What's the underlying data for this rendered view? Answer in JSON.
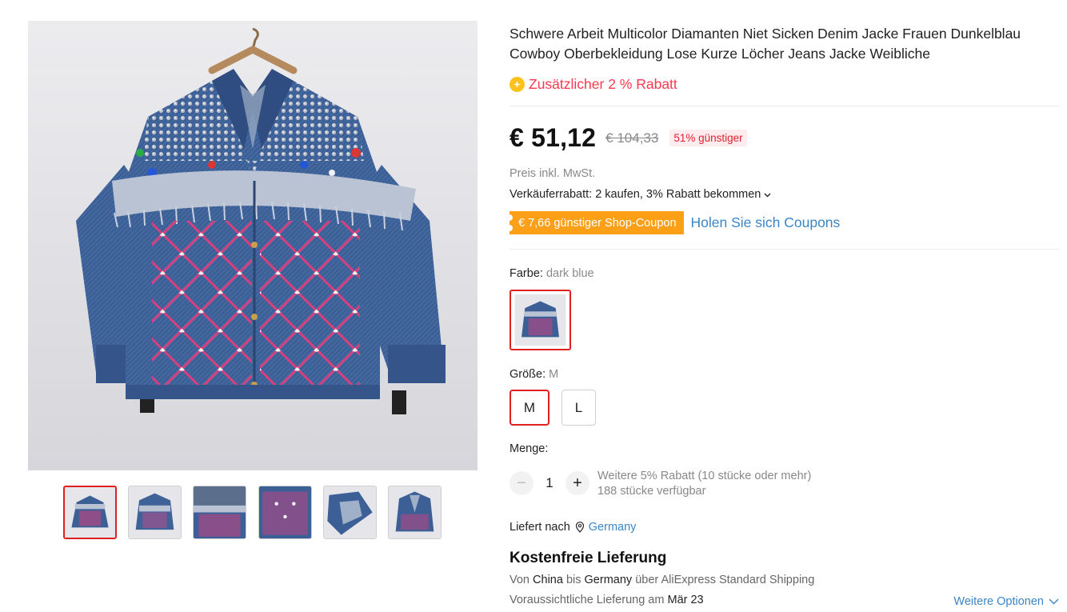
{
  "product": {
    "title": "Schwere Arbeit Multicolor Diamanten Niet Sicken Denim Jacke Frauen Dunkelblau Cowboy Oberbekleidung Lose Kurze Löcher Jeans Jacke Weibliche",
    "extra_discount": "Zusätzlicher 2 % Rabatt"
  },
  "price": {
    "current": "€ 51,12",
    "original": "€ 104,33",
    "discount_badge": "51% günstiger",
    "tax_note": "Preis inkl. MwSt.",
    "seller_discount": "Verkäuferrabatt: 2 kaufen, 3% Rabatt bekommen",
    "coupon_tag": "€ 7,66 günstiger Shop-Coupon",
    "coupon_link": "Holen Sie sich Coupons"
  },
  "color": {
    "label": "Farbe:",
    "value": "dark blue"
  },
  "size": {
    "label": "Größe:",
    "value": "M",
    "options": [
      "M",
      "L"
    ]
  },
  "quantity": {
    "label": "Menge:",
    "value": "1",
    "minus": "−",
    "plus": "+",
    "bulk_note": "Weitere 5% Rabatt (10 stücke oder mehr)",
    "stock_note": "188 stücke verfügbar"
  },
  "shipping": {
    "ship_to_label": "Liefert nach",
    "ship_to_country": "Germany",
    "title": "Kostenfreie Lieferung",
    "route_from": "Von",
    "route_origin": "China",
    "route_to": "bis",
    "route_destination": "Germany",
    "route_method": "über AliExpress Standard Shipping",
    "eta_label": "Voraussichtliche Lieferung am",
    "eta_date": "Mär 23",
    "more_options": "Weitere Optionen"
  },
  "colors": {
    "accent_red": "#e02020",
    "price_red": "#fd384f",
    "coupon_orange": "#fd9f17",
    "link_blue": "#3a86c7",
    "denim_blue": "#3c5f96",
    "bead_pink": "#d6407f"
  },
  "icons": {
    "extra_discount": "coin-plus-icon",
    "seller_discount": "chevron-down-icon",
    "ship_to": "location-pin-icon",
    "more_options": "chevron-down-icon"
  }
}
